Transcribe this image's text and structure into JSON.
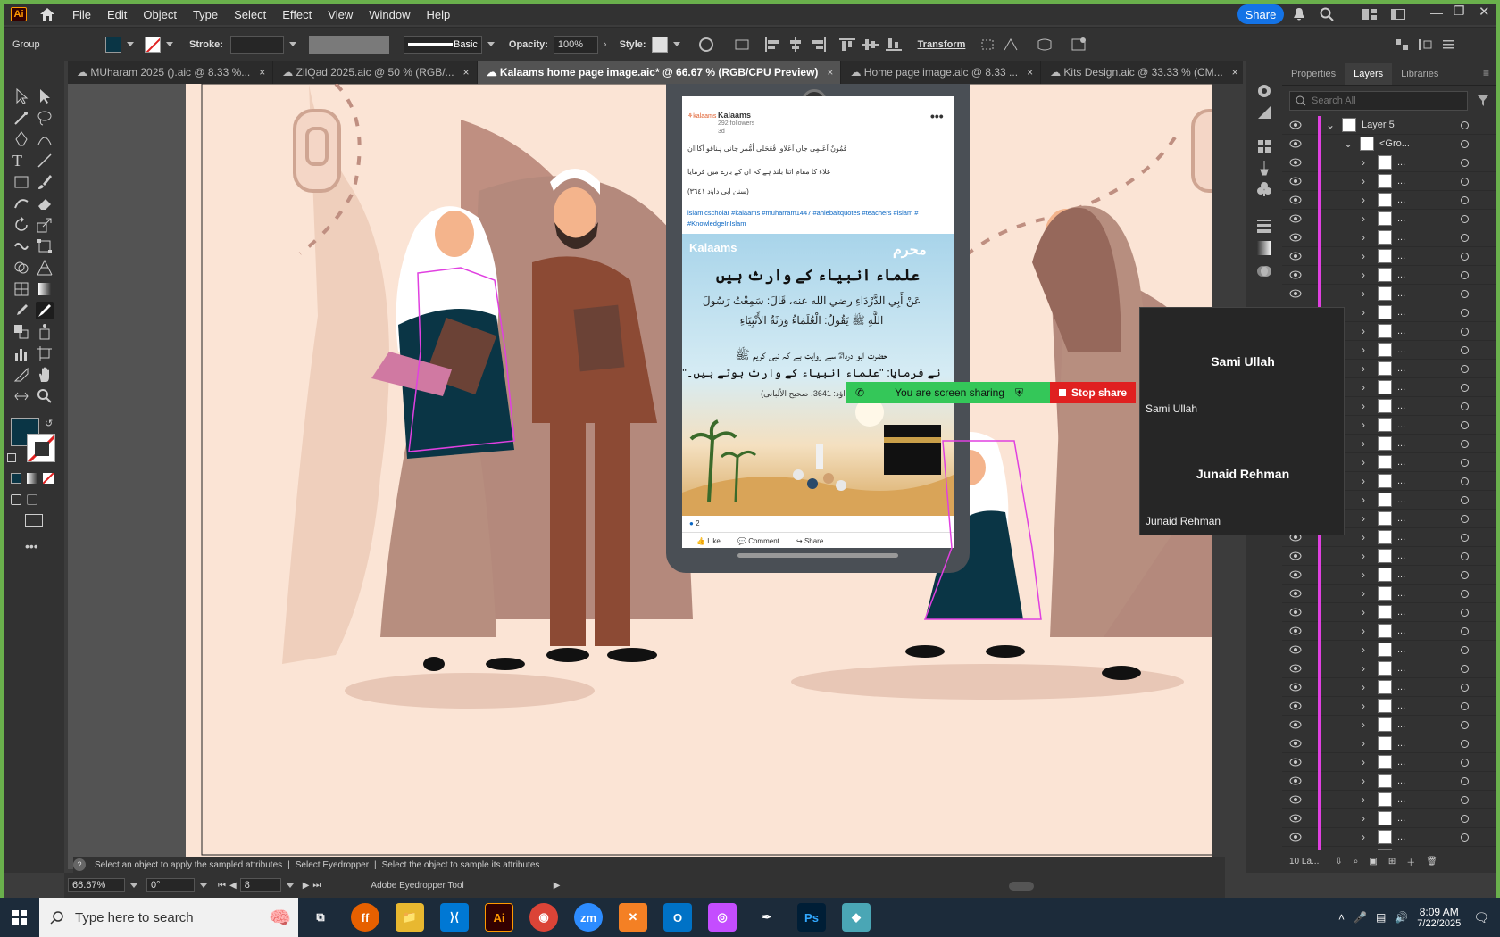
{
  "menu": {
    "items": [
      "File",
      "Edit",
      "Object",
      "Type",
      "Select",
      "Effect",
      "View",
      "Window",
      "Help"
    ],
    "share": "Share"
  },
  "control": {
    "group": "Group",
    "stroke_label": "Stroke:",
    "brush": "Basic",
    "opacity_label": "Opacity:",
    "opacity": "100%",
    "style_label": "Style:",
    "transform": "Transform"
  },
  "tabs": [
    {
      "label": "MUharam 2025 ().aic @ 8.33 %..."
    },
    {
      "label": "ZilQad 2025.aic @ 50 % (RGB/..."
    },
    {
      "label": "Kalaams home page image.aic* @ 66.67 % (RGB/CPU Preview)"
    },
    {
      "label": "Home page image.aic @ 8.33 ..."
    },
    {
      "label": "Kits Design.aic @ 33.33 % (CM..."
    }
  ],
  "post": {
    "name": "Kalaams",
    "followers": "292 followers",
    "time": "3d",
    "line1": "قَمُونٌ اَعَلمِی جاں اَعَلاوا قُعَحَلی اُمُّمرِ جانی ہناقو اَکااان",
    "line2": "علاء کا مقام اتنا بلند ہے کہ ان کے بارے میں فرمایا",
    "line3": "(سنن ابی داؤد ٣٦٤١)",
    "hashtags": "islamicscholar #kalaams #muharram1447 #ahlebaitquotes #teachers #islam #",
    "hashtags2": "#KnowledgeInIslam",
    "brand": "Kalaams",
    "arabic_logo": "محرم",
    "headline": "علماء انبیاء کے وارث ہیں",
    "arabic1": "عَنْ أَبِي الدَّرْدَاءِ رضي الله عنه، قَالَ: سَمِعْتُ رَسُولَ",
    "arabic2": "اللَّهِ ﷺ يَقُولُ: الْعُلَمَاءُ وَرَثَةُ الأَنْبِيَاءِ",
    "urdu1": "حضرت ابو درداءؓ سے روایت ہے کہ نبی کریم ﷺ",
    "urdu2": "نے فرمایا: \"علماء انبیاء کے وارث ہوتے ہیں۔\"",
    "ref": "(ابو داؤد: 3641، صحیح الألبانی)",
    "reactions": "2",
    "like": "Like",
    "comment": "Comment",
    "share": "Share"
  },
  "screenshare": {
    "text": "You are screen sharing",
    "stop": "Stop share"
  },
  "participants": [
    {
      "name": "Sami Ullah",
      "label": "Sami Ullah"
    },
    {
      "name": "Junaid Rehman",
      "label": "Junaid Rehman"
    }
  ],
  "panel": {
    "tabs": [
      "Properties",
      "Layers",
      "Libraries"
    ],
    "search_placeholder": "Search All",
    "layer": "Layer 5",
    "group": "<Gro...",
    "sublabel": "...",
    "layers_count": "10 La..."
  },
  "status": {
    "hint": "Select an object to apply the sampled attributes",
    "sep1": "|",
    "h2": "Select Eyedropper",
    "sep2": "|",
    "h3": "Select the object to sample its attributes",
    "zoom": "66.67%",
    "rotate": "0°",
    "artboard": "8",
    "tool": "Adobe Eyedropper Tool"
  },
  "taskbar": {
    "search": "Type here to search",
    "time": "8:09 AM",
    "date": "7/22/2025"
  },
  "colors": {
    "fill": "#0a3545",
    "canvas": "#fbe4d5",
    "accent": "#1473e6",
    "green": "#34c759",
    "red": "#e02020"
  }
}
